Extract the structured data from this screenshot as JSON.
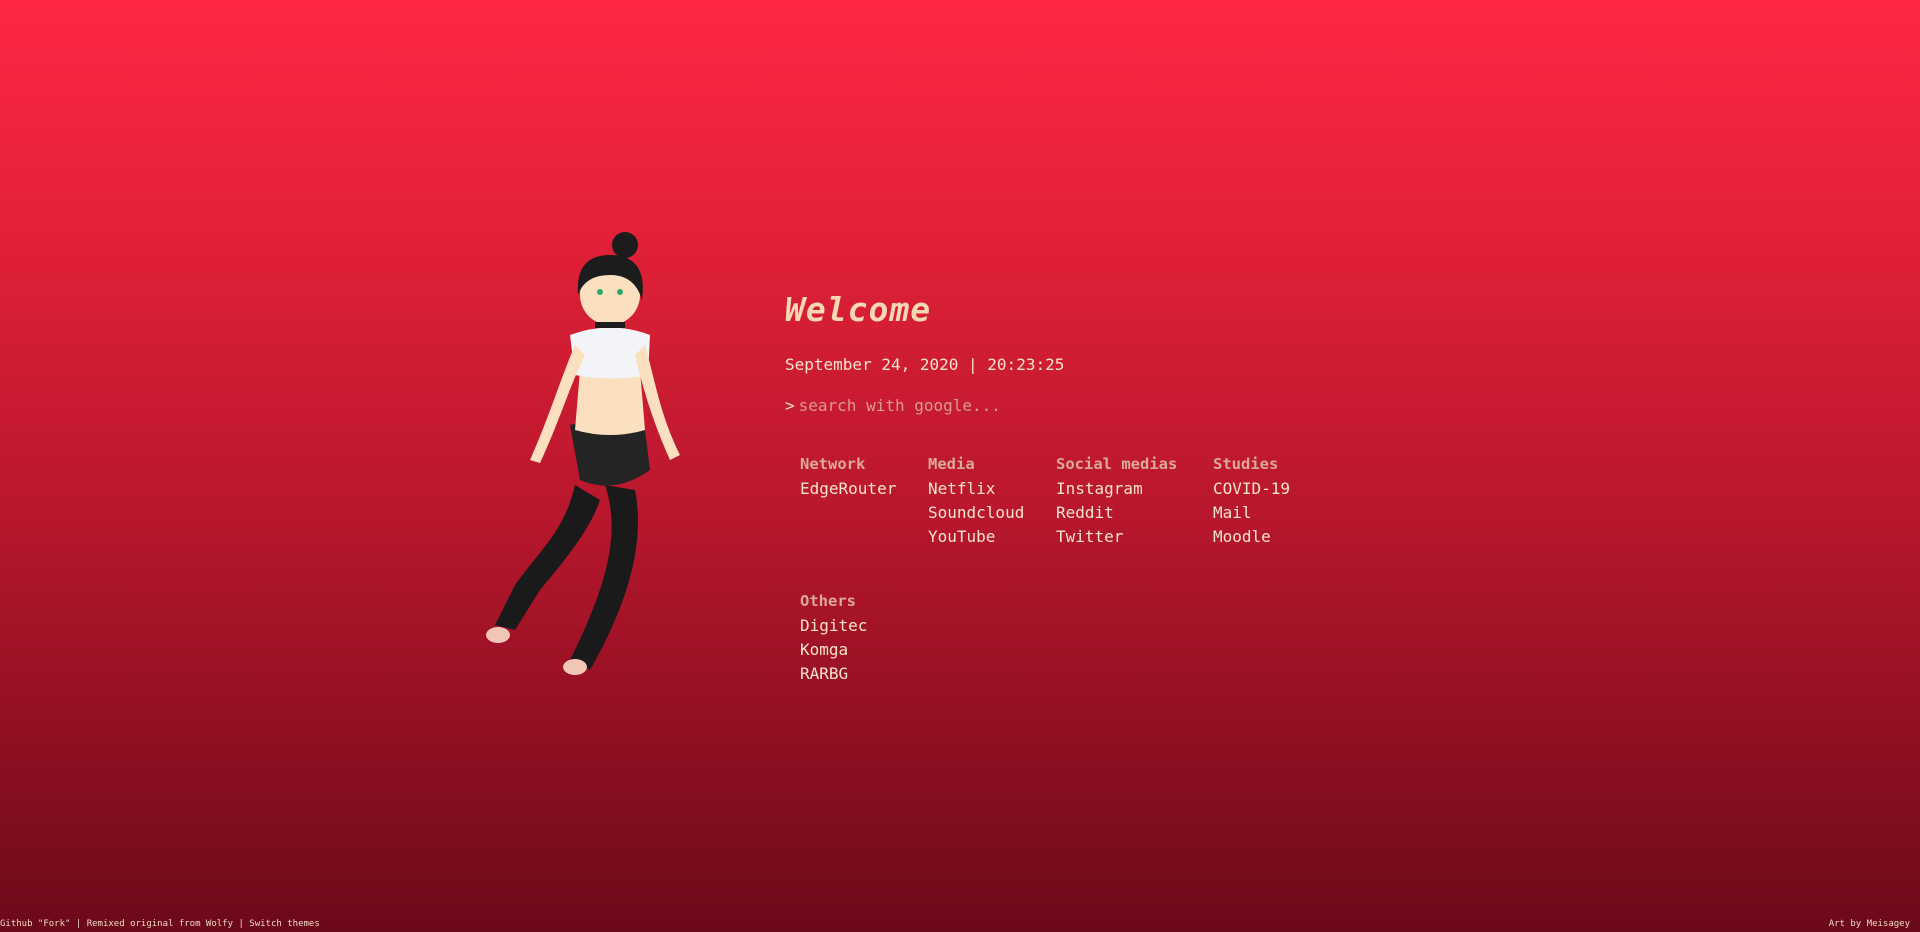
{
  "welcome": "Welcome",
  "datetime": "September 24, 2020 | 20:23:25",
  "search": {
    "prompt": ">",
    "placeholder": "search with google..."
  },
  "groups": [
    {
      "title": "Network",
      "links": [
        "EdgeRouter"
      ]
    },
    {
      "title": "Media",
      "links": [
        "Netflix",
        "Soundcloud",
        "YouTube"
      ]
    },
    {
      "title": "Social medias",
      "links": [
        "Instagram",
        "Reddit",
        "Twitter"
      ]
    },
    {
      "title": "Studies",
      "links": [
        "COVID-19",
        "Mail",
        "Moodle"
      ]
    },
    {
      "title": "Others",
      "links": [
        "Digitec",
        "Komga",
        "RARBG"
      ]
    }
  ],
  "footer": {
    "github": "Github \"Fork\"",
    "sep1": " | ",
    "remixed": "Remixed original from Wolfy",
    "sep2": " | ",
    "themes": "Switch themes",
    "art": "Art by Meisagey"
  },
  "colors": {
    "background_top": "#ff2742",
    "background_bottom": "#6b0a19",
    "heading": "#f3d8b2",
    "group_title": "#dba996",
    "text": "#f6e3cd"
  }
}
